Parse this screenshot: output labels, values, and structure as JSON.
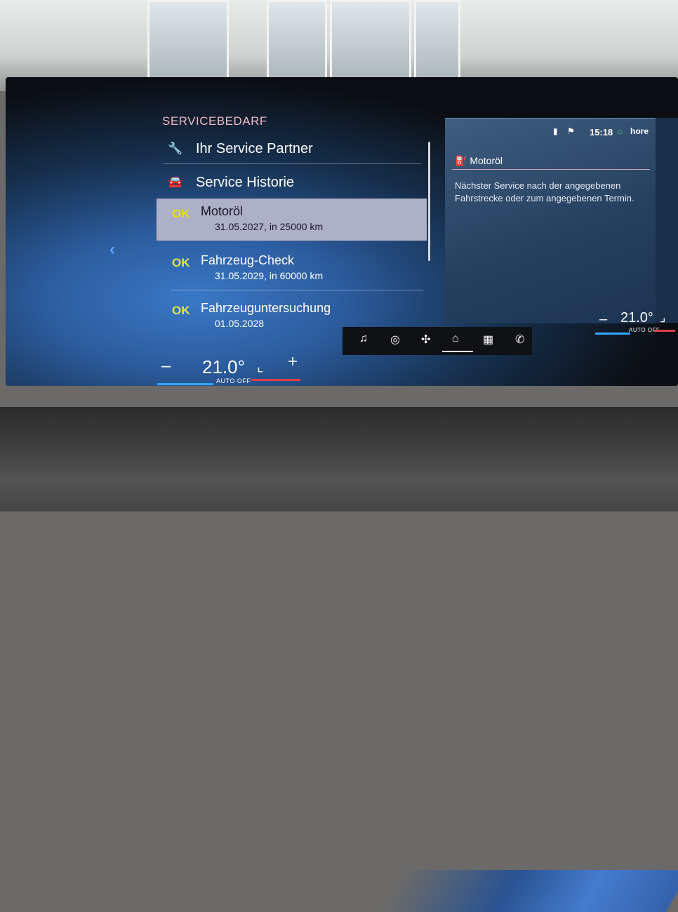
{
  "service_panel": {
    "title": "SERVICEBEDARF",
    "menu": [
      {
        "label": "Ihr Service Partner",
        "icon": "wrench-icon"
      },
      {
        "label": "Service Historie",
        "icon": "service-history-icon"
      }
    ],
    "items": [
      {
        "status": "OK",
        "name": "Motoröl",
        "detail": "31.05.2027, in 25000 km",
        "selected": true
      },
      {
        "status": "OK",
        "name": "Fahrzeug-Check",
        "detail": "31.05.2029, in 60000 km",
        "selected": false
      },
      {
        "status": "OK",
        "name": "Fahrzeuguntersuchung",
        "detail": "01.05.2028",
        "selected": false
      }
    ]
  },
  "detail_panel": {
    "title": "Motoröl",
    "icon": "oil-can-icon",
    "description": "Nächster Service nach der angegebenen Fahrstrecke oder zum angegebenen Termin."
  },
  "status_bar": {
    "time": "15:18",
    "user": "hore"
  },
  "climate_left": {
    "minus": "–",
    "temp": "21.0°",
    "mode": "AUTO OFF",
    "plus": "+"
  },
  "climate_right": {
    "minus": "–",
    "temp": "21.0°",
    "mode": "AUTO OFF"
  },
  "dock": [
    "music-note-icon",
    "navigation-icon",
    "fan-icon",
    "home-icon",
    "apps-grid-icon",
    "phone-icon"
  ],
  "colors": {
    "accent_title": "#f1b9c6",
    "ok_yellow": "#e6e44a",
    "selected_row": "#aeb0c7",
    "cold_blue": "#35a7ff",
    "warm_red": "#e23d4a"
  }
}
